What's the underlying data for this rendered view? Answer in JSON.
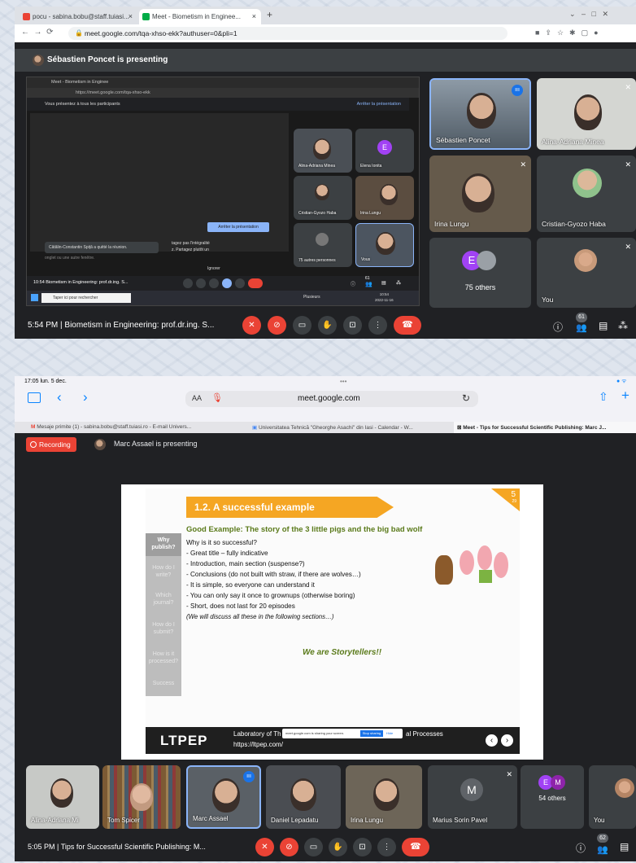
{
  "top": {
    "browser_tabs": [
      {
        "label": "pocu - sabina.bobu@staff.tuiasi...",
        "close": "×"
      },
      {
        "label": "Meet - Biometism in Enginee...",
        "close": "×"
      }
    ],
    "new_tab": "+",
    "url": "meet.google.com/tqa-xhso-ekk?authuser=0&pli=1",
    "presenting_banner": "Sébastien Poncet is presenting",
    "inner_screen": {
      "tab_label": "Meet - Biometism in Enginee",
      "url": "https://meet.google.com/tqa-xhso-ekk",
      "sharing_notice": "Vous présentez à tous les participants",
      "stop_sharing_link": "Arrêter la présentation",
      "left_notice": "Cătălin-Constantin Spiță a quitté la réunion.",
      "share_prompt_line1": "tagez pas l'intégralité",
      "share_prompt_line2": "z. Partagez plutôt un",
      "stop_button": "Arrêter la présentation",
      "ignore_button": "Ignorer",
      "bg_text": "onglet ou une autre fenêtre.",
      "meeting_info": "10:54   Biometism in Engineering: prof.dr.ing. S...",
      "taskbar_search": "Taper ici pour rechercher",
      "taskbar_weather": "Plusieurs",
      "taskbar_clock_time": "10:54",
      "taskbar_clock_date": "2022-11-16",
      "people_count": "61",
      "tiles": [
        {
          "name": "Alina-Adriana Minea"
        },
        {
          "name": "Elena Ionita",
          "letter": "E"
        },
        {
          "name": "Cristian-Gyozo Haba"
        },
        {
          "name": "Irina Lungu"
        },
        {
          "name": "75 autres personnes"
        },
        {
          "name": "Vous"
        }
      ]
    },
    "participants": [
      {
        "name": "Sébastien Poncet"
      },
      {
        "name": "Alina-Adriana Minea"
      },
      {
        "name": "Irina Lungu"
      },
      {
        "name": "Cristian-Gyozo Haba"
      },
      {
        "name": "75 others",
        "letter": "E"
      },
      {
        "name": "You"
      }
    ],
    "meeting_info": "5:54 PM  |  Biometism in Engineering: prof.dr.ing. S...",
    "people_count": "61"
  },
  "bottom": {
    "status_time": "17:05  lun. 5 dec.",
    "text_size_btn": "AA",
    "url": "meet.google.com",
    "tabs": [
      "Mesaje primite (1) - sabina.bobu@staff.tuiasi.ro - E-mail Univers...",
      "Universitatea Tehnică \"Gheorghe Asachi\" din Iasi - Calendar - W...",
      "Meet - Tips for Successful Scientific Publishing: Marc J..."
    ],
    "recording_label": "Recording",
    "presenting_banner": "Marc Assael is presenting",
    "slide": {
      "number": "5",
      "sub_number": "29",
      "heading": "1.2. A successful example",
      "nav": [
        "Why publish?",
        "How do I write?",
        "Which journal?",
        "How do I submit?",
        "How is it processed?",
        "Success"
      ],
      "title": "Good Example: The story of the 3 little pigs and the big bad wolf",
      "lines": [
        "Why is it so successful?",
        "- Great title – fully indicative",
        "- Introduction, main section (suspense?)",
        "- Conclusions (do not built with straw, if there are wolves…)",
        "- It is simple, so everyone can understand it",
        "- You can only say it once to grownups (otherwise boring)",
        "- Short, does not last for 20 episodes"
      ],
      "note": "(We will discuss all these in the following sections…)",
      "tagline": "We are Storytellers!!",
      "footer_logo": "LTPEP",
      "footer_text_1": "Laboratory of Th",
      "footer_text_2": "al Processes",
      "footer_url": "https://ltpep.com/",
      "share_bar_text": "meet.google.com is sharing your screen.",
      "stop_sharing": "Stop sharing",
      "hide": "Hide"
    },
    "participants": [
      {
        "name": "Alina-Adriana Mi"
      },
      {
        "name": "Tom Spicer"
      },
      {
        "name": "Marc Assael"
      },
      {
        "name": "Daniel Lepadatu"
      },
      {
        "name": "Irina Lungu"
      },
      {
        "name": "Marius Sorin Pavel",
        "letter": "M"
      },
      {
        "name": "54 others",
        "letters": [
          "E",
          "M"
        ]
      },
      {
        "name": "You"
      }
    ],
    "meeting_info": "5:05 PM  |  Tips for Successful Scientific Publishing: M...",
    "people_count": "62"
  },
  "colors": {
    "meet_red": "#ea4335",
    "meet_dark": "#202124",
    "tile_gray": "#3c4043",
    "speaking_blue": "#8ab4f8",
    "slide_orange": "#f5a623",
    "slide_green": "#5a7a1a"
  }
}
